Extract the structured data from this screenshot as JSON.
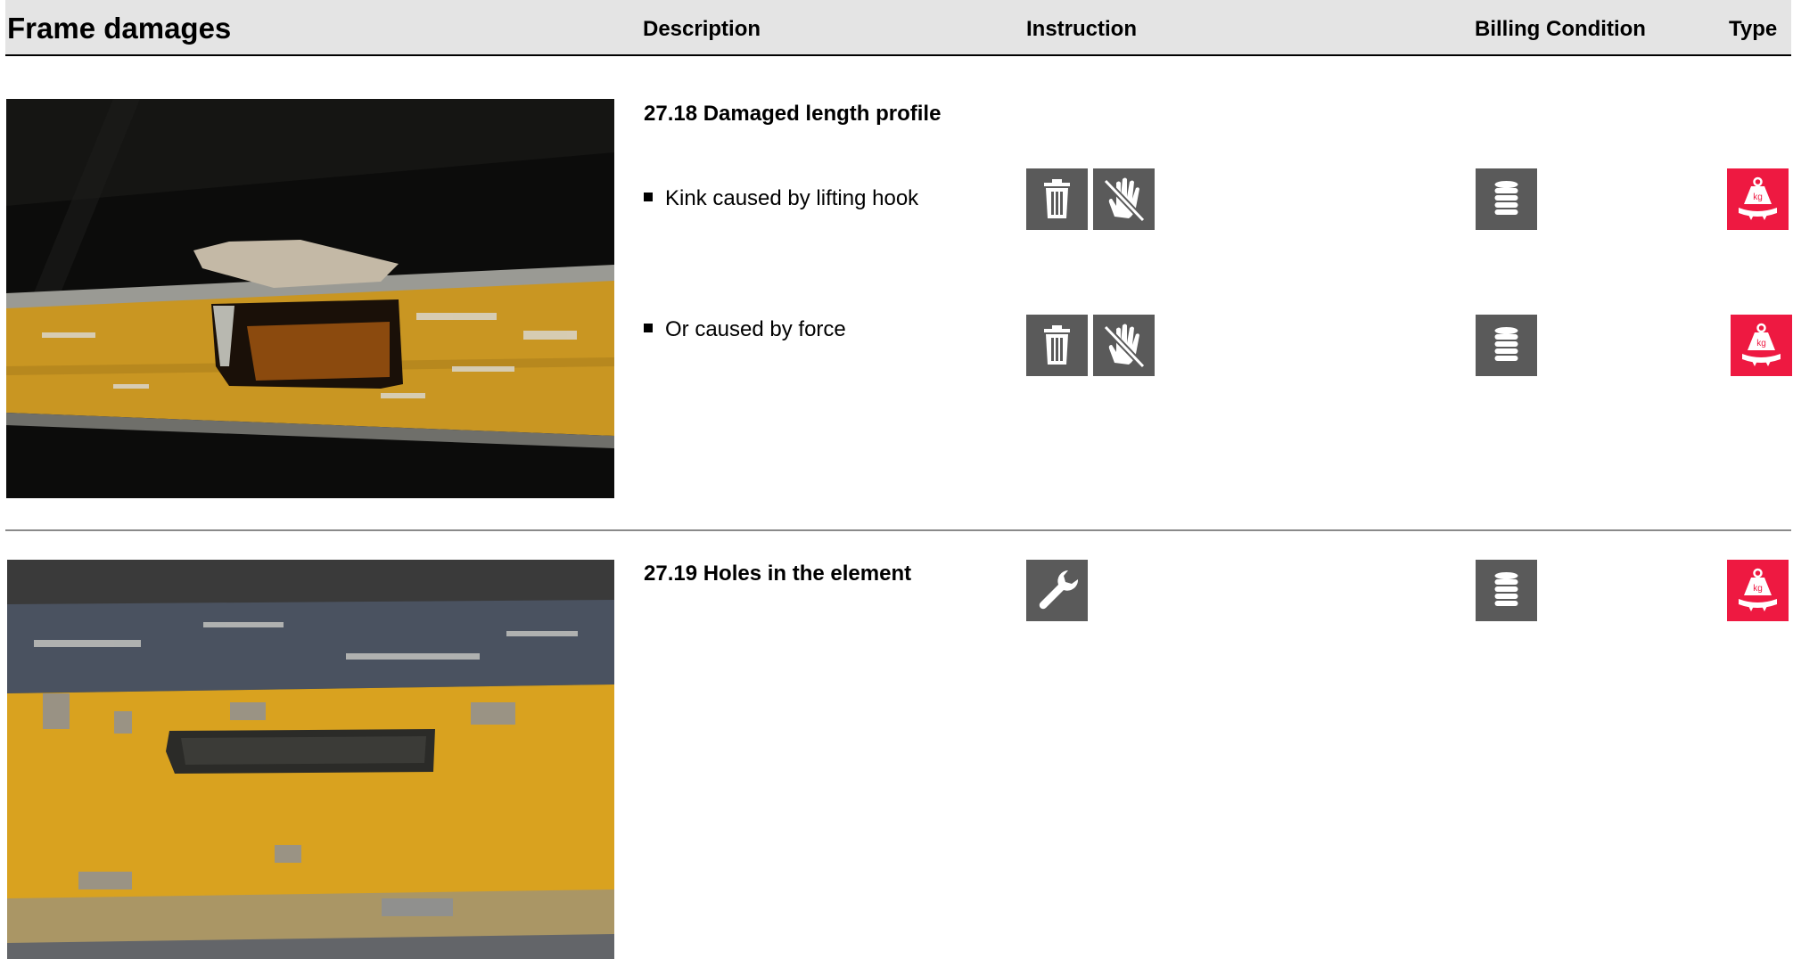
{
  "header": {
    "title": "Frame damages",
    "columns": {
      "description": "Description",
      "instruction": "Instruction",
      "billing": "Billing Condition",
      "type": "Type"
    }
  },
  "sections": [
    {
      "title": "27.18 Damaged length profile",
      "items": [
        {
          "text": "Kink caused by lifting hook",
          "instruction_icons": [
            "trash-icon",
            "no-touch-icon"
          ],
          "billing_icon": "coins-stack-icon",
          "type_icon": "weight-kg-icon"
        },
        {
          "text": "Or caused by force",
          "instruction_icons": [
            "trash-icon",
            "no-touch-icon"
          ],
          "billing_icon": "coins-stack-icon",
          "type_icon": "weight-kg-icon"
        }
      ]
    },
    {
      "title": "27.19 Holes in the element",
      "instruction_icons": [
        "wrench-icon"
      ],
      "billing_icon": "coins-stack-icon",
      "type_icon": "weight-kg-icon"
    }
  ],
  "icon_labels": {
    "weight": "kg"
  },
  "colors": {
    "header_bg": "#e4e4e4",
    "icon_gray": "#5a5a5a",
    "icon_red": "#ee1941",
    "profile_yellow": "#e5a625"
  }
}
